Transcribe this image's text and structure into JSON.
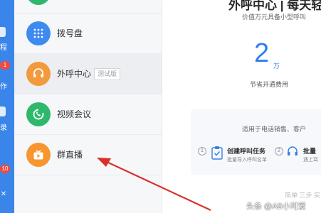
{
  "colors": {
    "rail_blue": "#3a85ea",
    "dialpad_blue": "#3d8af0",
    "callcenter_orange": "#f39a3c",
    "video_green": "#2fb86c",
    "live_orange": "#f7962e",
    "stat_blue": "#2f7ef0",
    "arrow_red": "#d9302a"
  },
  "left_rail": {
    "glyphs": [
      "程",
      "作",
      "录"
    ],
    "badges": [
      "1",
      "10"
    ]
  },
  "menu": {
    "items": [
      {
        "label": "拨号盘",
        "icon": "dialpad-icon"
      },
      {
        "label": "外呼中心",
        "icon": "headset-icon",
        "tag": "测试版"
      },
      {
        "label": "视频会议",
        "icon": "video-call-icon"
      },
      {
        "label": "群直播",
        "icon": "live-tv-icon"
      }
    ]
  },
  "main": {
    "title": "外呼中心 | 每天轻松",
    "subtitle": "价值万元具备小型呼叫",
    "stat": {
      "value": "2",
      "unit": "万",
      "label": "节省开通费用"
    },
    "card": {
      "desc": "适用于电话销售、客户",
      "steps": [
        {
          "number": "1",
          "title": "创建呼叫任务",
          "desc": "批量导入呼叫名单"
        },
        {
          "number": "2",
          "title": "批量",
          "desc": "遇上耳"
        }
      ]
    },
    "footer_text": "简单 三步 实"
  },
  "watermark": "头条 @AB小可爱"
}
